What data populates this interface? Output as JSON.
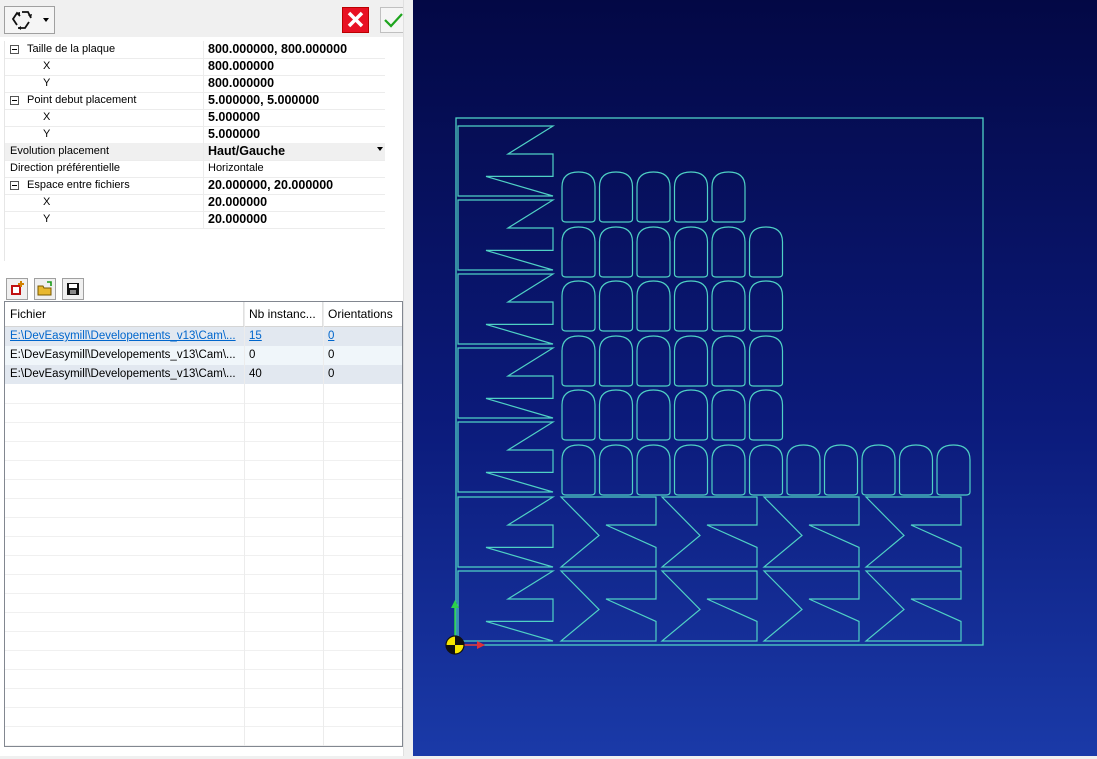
{
  "toolbar": {
    "nest_icon": "recycle-icon",
    "cancel_icon": "close-icon",
    "ok_icon": "check-icon"
  },
  "properties": [
    {
      "name": "Taille de la plaque",
      "value": "800.000000, 800.000000",
      "level": 0,
      "expander": true,
      "bold": true
    },
    {
      "name": "X",
      "value": "800.000000",
      "level": 1,
      "expander": false,
      "bold": true
    },
    {
      "name": "Y",
      "value": "800.000000",
      "level": 1,
      "expander": false,
      "bold": true
    },
    {
      "name": "Point debut placement",
      "value": "5.000000, 5.000000",
      "level": 0,
      "expander": true,
      "bold": true
    },
    {
      "name": "X",
      "value": "5.000000",
      "level": 1,
      "expander": false,
      "bold": true
    },
    {
      "name": "Y",
      "value": "5.000000",
      "level": 1,
      "expander": false,
      "bold": true
    },
    {
      "name": "Evolution placement",
      "value": "Haut/Gauche",
      "level": -1,
      "expander": false,
      "bold": true,
      "combo": true
    },
    {
      "name": "Direction préférentielle",
      "value": "Horizontale",
      "level": -1,
      "expander": false,
      "bold": false
    },
    {
      "name": "Espace entre fichiers",
      "value": "20.000000, 20.000000",
      "level": 0,
      "expander": true,
      "bold": true
    },
    {
      "name": "X",
      "value": "20.000000",
      "level": 1,
      "expander": false,
      "bold": true
    },
    {
      "name": "Y",
      "value": "20.000000",
      "level": 1,
      "expander": false,
      "bold": true
    }
  ],
  "files_toolbar": {
    "add_icon": "add-file-icon",
    "open_icon": "open-folder-icon",
    "save_icon": "save-icon"
  },
  "grid": {
    "columns": [
      "Fichier",
      "Nb instanc...",
      "Orientations"
    ],
    "rows": [
      {
        "file": "E:\\DevEasymill\\Developements_v13\\Cam\\...",
        "count": "15",
        "orient": "0",
        "link": true
      },
      {
        "file": "E:\\DevEasymill\\Developements_v13\\Cam\\...",
        "count": "0",
        "orient": "0",
        "link": false
      },
      {
        "file": "E:\\DevEasymill\\Developements_v13\\Cam\\...",
        "count": "40",
        "orient": "0",
        "link": false
      }
    ]
  },
  "viewport": {
    "line_color": "#4fd1c5",
    "axis_x_color": "#e0303a",
    "axis_y_color": "#2bd14a",
    "origin_icon": "origin-marker-icon"
  }
}
